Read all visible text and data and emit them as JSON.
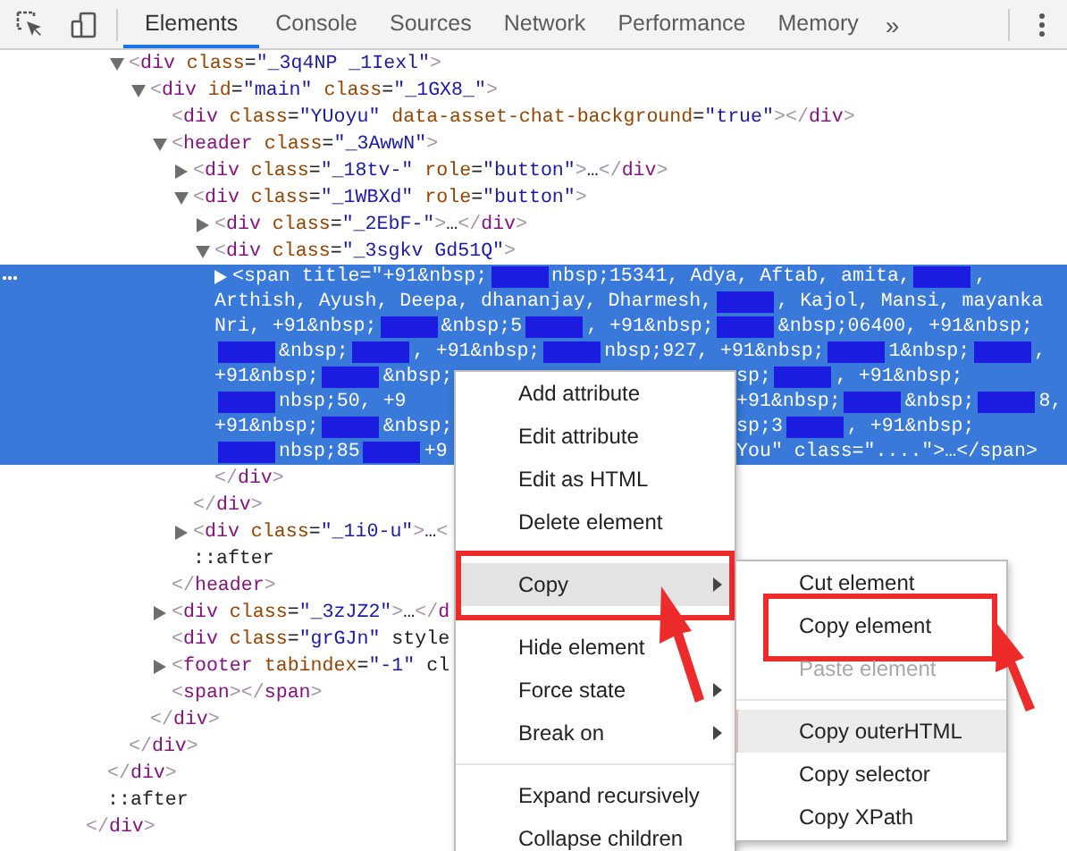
{
  "toolbar": {
    "tabs": [
      {
        "label": "Elements",
        "selected": true
      },
      {
        "label": "Console",
        "selected": false
      },
      {
        "label": "Sources",
        "selected": false
      },
      {
        "label": "Network",
        "selected": false
      },
      {
        "label": "Performance",
        "selected": false
      },
      {
        "label": "Memory",
        "selected": false
      }
    ],
    "overflow": "»"
  },
  "dom_tree": [
    {
      "children": [
        {
          "children": [
            {
              "open": "<div class=\"_3q4NP _1Iexl\">",
              "expanded": true,
              "selected": false,
              "children": [
                {
                  "open": "<div id=\"main\" class=\"_1GX8_\">",
                  "expanded": true,
                  "selected": false,
                  "children": [
                    {
                      "open": "<div class=\"YUoyu\" data-asset-chat-background=\"true\"></div>",
                      "selected": false
                    },
                    {
                      "open": "<header class=\"_3AwwN\">",
                      "expanded": true,
                      "selected": false,
                      "children": [
                        {
                          "open": "<div class=\"_18tv-\" role=\"button\">…</div>",
                          "expanded": false,
                          "selected": false
                        },
                        {
                          "open": "<div class=\"_1WBXd\" role=\"button\">",
                          "expanded": true,
                          "selected": false,
                          "children": [
                            {
                              "open": "<div class=\"_2EbF-\">…</div>",
                              "expanded": false,
                              "selected": false
                            },
                            {
                              "open": "<div class=\"_3sgkv Gd51Q\">",
                              "expanded": true,
                              "selected": false,
                              "children": [
                                {
                                  "expanded": false,
                                  "selected": true,
                                  "lines": [
                                    [
                                      {
                                        "kind": "text",
                                        "text": "<span title=\"+91&nbsp;"
                                      },
                                      {
                                        "kind": "redacted"
                                      },
                                      {
                                        "kind": "text",
                                        "text": "nbsp;15341, Adya, Aftab, amita,"
                                      },
                                      {
                                        "kind": "redacted"
                                      },
                                      {
                                        "kind": "text",
                                        "text": ","
                                      }
                                    ],
                                    [
                                      {
                                        "kind": "text",
                                        "text": "Arthish, Ayush, Deepa, dhananjay, Dharmesh,"
                                      },
                                      {
                                        "kind": "redacted"
                                      },
                                      {
                                        "kind": "text",
                                        "text": ", Kajol, Mansi, mayanka"
                                      }
                                    ],
                                    [
                                      {
                                        "kind": "text",
                                        "text": "Nri, +91&nbsp;"
                                      },
                                      {
                                        "kind": "redacted"
                                      },
                                      {
                                        "kind": "text",
                                        "text": "&nbsp;5"
                                      },
                                      {
                                        "kind": "redacted"
                                      },
                                      {
                                        "kind": "text",
                                        "text": ", +91&nbsp;"
                                      },
                                      {
                                        "kind": "redacted"
                                      },
                                      {
                                        "kind": "text",
                                        "text": "&nbsp;06400, +91&nbsp;"
                                      }
                                    ],
                                    [
                                      {
                                        "kind": "redacted"
                                      },
                                      {
                                        "kind": "text",
                                        "text": "&nbsp;"
                                      },
                                      {
                                        "kind": "redacted"
                                      },
                                      {
                                        "kind": "text",
                                        "text": ", +91&nbsp;"
                                      },
                                      {
                                        "kind": "redacted"
                                      },
                                      {
                                        "kind": "text",
                                        "text": "nbsp;927, +91&nbsp;"
                                      },
                                      {
                                        "kind": "redacted"
                                      },
                                      {
                                        "kind": "text",
                                        "text": "1&nbsp;"
                                      },
                                      {
                                        "kind": "redacted"
                                      },
                                      {
                                        "kind": "text",
                                        "text": ","
                                      }
                                    ],
                                    [
                                      {
                                        "kind": "text",
                                        "text": "+91&nbsp;"
                                      },
                                      {
                                        "kind": "redacted"
                                      },
                                      {
                                        "kind": "text",
                                        "text": "&nbsp;"
                                      },
                                      {
                                        "kind": "covered"
                                      },
                                      {
                                        "kind": "text",
                                        "text": "sp;"
                                      },
                                      {
                                        "kind": "redacted"
                                      },
                                      {
                                        "kind": "text",
                                        "text": ", +91&nbsp;"
                                      }
                                    ],
                                    [
                                      {
                                        "kind": "redacted"
                                      },
                                      {
                                        "kind": "text",
                                        "text": "nbsp;50"
                                      },
                                      {
                                        "kind": "text",
                                        "text": ", +9"
                                      },
                                      {
                                        "kind": "covered"
                                      },
                                      {
                                        "kind": "text",
                                        "text": "+91&nbsp;"
                                      },
                                      {
                                        "kind": "redacted"
                                      },
                                      {
                                        "kind": "text",
                                        "text": "&nbsp;"
                                      },
                                      {
                                        "kind": "redacted"
                                      },
                                      {
                                        "kind": "text",
                                        "text": "8,"
                                      }
                                    ],
                                    [
                                      {
                                        "kind": "text",
                                        "text": "+91&nbsp;"
                                      },
                                      {
                                        "kind": "redacted"
                                      },
                                      {
                                        "kind": "text",
                                        "text": "&nbsp;"
                                      },
                                      {
                                        "kind": "covered"
                                      },
                                      {
                                        "kind": "text",
                                        "text": "sp;3"
                                      },
                                      {
                                        "kind": "redacted"
                                      },
                                      {
                                        "kind": "text",
                                        "text": ", +91&nbsp;"
                                      }
                                    ],
                                    [
                                      {
                                        "kind": "redacted"
                                      },
                                      {
                                        "kind": "text",
                                        "text": "nbsp;85"
                                      },
                                      {
                                        "kind": "redacted"
                                      },
                                      {
                                        "kind": "text",
                                        "text": "+9"
                                      },
                                      {
                                        "kind": "covered"
                                      },
                                      {
                                        "kind": "text",
                                        "text": "You\" class=\"....\">…</span>"
                                      }
                                    ]
                                  ]
                                }
                              ],
                              "close": "</div>"
                            }
                          ],
                          "close": "</div>"
                        },
                        {
                          "open": "<div class=\"_1i0-u\">…<",
                          "expanded": false,
                          "selected": false
                        },
                        {
                          "open": "::after",
                          "selected": false
                        }
                      ],
                      "close": "</header>"
                    },
                    {
                      "open": "<div class=\"_3zJZ2\">…</d",
                      "expanded": false,
                      "selected": false
                    },
                    {
                      "open": "<div class=\"grGJn\" style",
                      "selected": false
                    },
                    {
                      "open": "<footer tabindex=\"-1\" cl",
                      "expanded": false,
                      "selected": false
                    },
                    {
                      "open": "<span></span>",
                      "selected": false
                    }
                  ],
                  "close": "</div>"
                }
              ],
              "close": "</div>"
            }
          ],
          "close": "</div>"
        },
        {
          "open": "::after",
          "selected": false
        }
      ],
      "close": "</div>"
    }
  ],
  "context_menu": {
    "items": [
      {
        "kind": "item",
        "label": "Add attribute",
        "submenu": false,
        "highlighted": false,
        "disabled": false,
        "annotated": false
      },
      {
        "kind": "item",
        "label": "Edit attribute",
        "submenu": false,
        "highlighted": false,
        "disabled": false,
        "annotated": false
      },
      {
        "kind": "item",
        "label": "Edit as HTML",
        "submenu": false,
        "highlighted": false,
        "disabled": false,
        "annotated": false
      },
      {
        "kind": "item",
        "label": "Delete element",
        "submenu": false,
        "highlighted": false,
        "disabled": false,
        "annotated": false
      },
      {
        "kind": "separator"
      },
      {
        "kind": "item",
        "label": "Copy",
        "submenu": true,
        "highlighted": true,
        "disabled": false,
        "annotated": true
      },
      {
        "kind": "separator"
      },
      {
        "kind": "item",
        "label": "Hide element",
        "submenu": false,
        "highlighted": false,
        "disabled": false,
        "annotated": false
      },
      {
        "kind": "item",
        "label": "Force state",
        "submenu": true,
        "highlighted": false,
        "disabled": false,
        "annotated": false
      },
      {
        "kind": "item",
        "label": "Break on",
        "submenu": true,
        "highlighted": false,
        "disabled": false,
        "annotated": false
      },
      {
        "kind": "separator"
      },
      {
        "kind": "item",
        "label": "Expand recursively",
        "submenu": false,
        "highlighted": false,
        "disabled": false,
        "annotated": false
      },
      {
        "kind": "item",
        "label": "Collapse children",
        "submenu": false,
        "highlighted": false,
        "disabled": false,
        "annotated": false
      }
    ]
  },
  "submenu": {
    "items": [
      {
        "kind": "item",
        "label": "Cut element",
        "submenu": false,
        "highlighted": false,
        "disabled": false,
        "annotated": false
      },
      {
        "kind": "item",
        "label": "Copy element",
        "submenu": false,
        "highlighted": false,
        "disabled": false,
        "annotated": true
      },
      {
        "kind": "item",
        "label": "Paste element",
        "submenu": false,
        "highlighted": false,
        "disabled": true,
        "annotated": false
      },
      {
        "kind": "separator"
      },
      {
        "kind": "item",
        "label": "Copy outerHTML",
        "submenu": false,
        "highlighted": true,
        "disabled": false,
        "annotated": false
      },
      {
        "kind": "item",
        "label": "Copy selector",
        "submenu": false,
        "highlighted": false,
        "disabled": false,
        "annotated": false
      },
      {
        "kind": "item",
        "label": "Copy XPath",
        "submenu": false,
        "highlighted": false,
        "disabled": false,
        "annotated": false
      }
    ]
  }
}
